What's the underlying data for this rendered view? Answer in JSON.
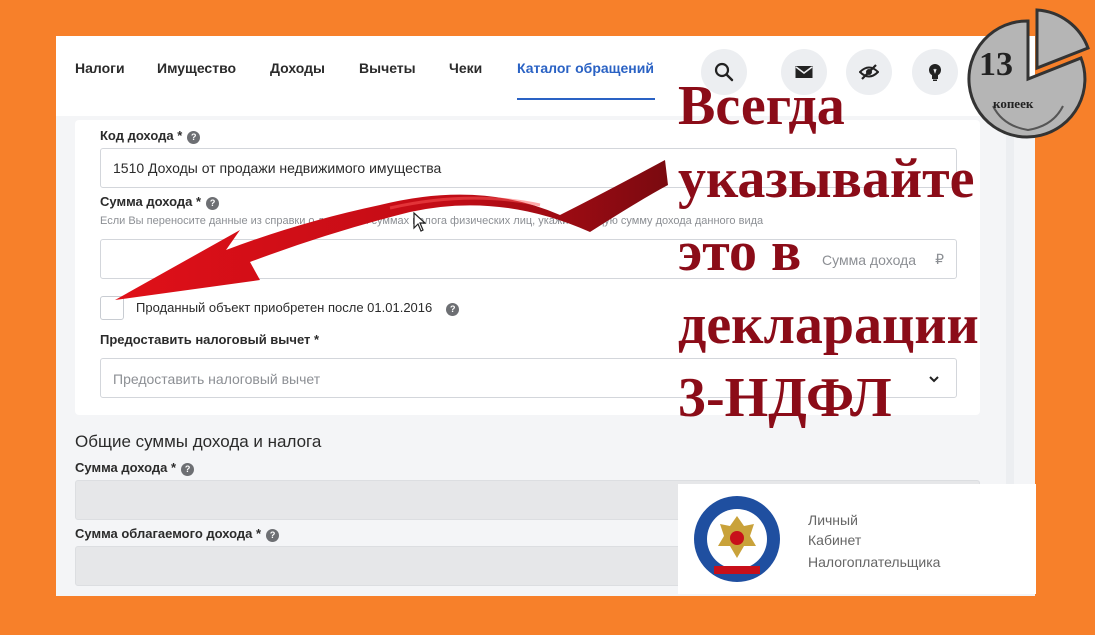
{
  "nav": {
    "tabs": [
      {
        "label": "Налоги"
      },
      {
        "label": "Имущество"
      },
      {
        "label": "Доходы"
      },
      {
        "label": "Вычеты"
      },
      {
        "label": "Чеки"
      },
      {
        "label": "Каталог обращений"
      }
    ],
    "active_tab": "Каталог обращений",
    "icons": [
      "search-icon",
      "mail-icon",
      "eye-off-icon",
      "lightbulb-icon"
    ]
  },
  "form": {
    "income_code": {
      "label": "Код дохода *",
      "value": "1510 Доходы от продажи недвижимого имущества"
    },
    "income_amount": {
      "label": "Сумма дохода *",
      "hint": "Если Вы переносите данные из справки о доходах и суммах налога физических лиц, укажите общую сумму дохода данного вида",
      "placeholder": "Сумма дохода",
      "currency": "₽"
    },
    "acquired_after": {
      "label": "Проданный объект приобретен после 01.01.2016",
      "checked": false
    },
    "tax_deduction": {
      "label": "Предоставить налоговый вычет *",
      "placeholder": "Предоставить налоговый вычет"
    }
  },
  "totals": {
    "title": "Общие суммы дохода и налога",
    "income_label": "Сумма дохода *",
    "taxable_label": "Сумма облагаемого дохода *"
  },
  "logo_panel": {
    "line1": "Личный",
    "line2": "Кабинет",
    "line3": "Налогоплательщика"
  },
  "caption": {
    "lines": [
      "Всегда",
      "указывайте",
      "это в",
      "декларации",
      "3-НДФЛ"
    ]
  },
  "badge": {
    "number": "13",
    "word": "копеек"
  },
  "colors": {
    "frame": "#f7802a",
    "accent": "#2a62c4",
    "caption": "#8b0c18",
    "arrow": "#c8101a"
  }
}
